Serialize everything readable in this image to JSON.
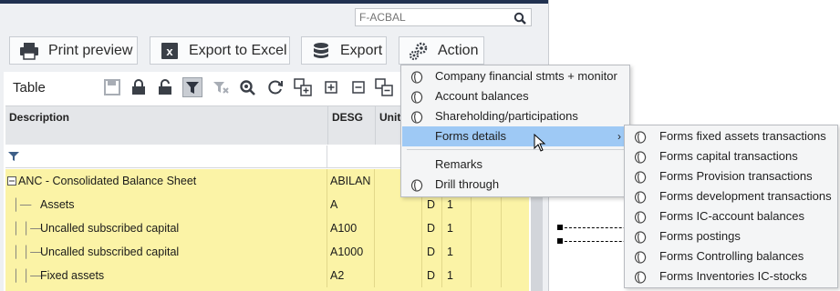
{
  "search": {
    "placeholder": "F-ACBAL"
  },
  "toolbar": {
    "print_label": "Print preview",
    "export_excel_label": "Export to Excel",
    "export_label": "Export",
    "action_label": "Action"
  },
  "table": {
    "title": "Table",
    "columns": [
      "Description",
      "DESG",
      "Unit"
    ],
    "rows": [
      {
        "desc": "ANC - Consolidated Balance Sheet",
        "desg": "ABILAN",
        "d": "",
        "n": ""
      },
      {
        "desc": "Assets",
        "desg": "A",
        "d": "D",
        "n": "1"
      },
      {
        "desc": "Uncalled subscribed capital",
        "desg": "A100",
        "d": "D",
        "n": "1"
      },
      {
        "desc": "Uncalled subscribed capital",
        "desg": "A1000",
        "d": "D",
        "n": "1"
      },
      {
        "desc": "Fixed assets",
        "desg": "A2",
        "d": "D",
        "n": "1"
      }
    ]
  },
  "action_menu": {
    "items": [
      {
        "label": "Company financial stmts + monitor"
      },
      {
        "label": "Account balances"
      },
      {
        "label": "Shareholding/participations"
      },
      {
        "label": "Forms details"
      },
      {
        "label": "Remarks"
      },
      {
        "label": "Drill through"
      }
    ],
    "highlight_color": "#9ec9f5"
  },
  "submenu": {
    "items": [
      {
        "label": "Forms fixed assets transactions"
      },
      {
        "label": "Forms capital transactions"
      },
      {
        "label": "Forms Provision transactions"
      },
      {
        "label": "Forms development transactions"
      },
      {
        "label": "Forms IC-account balances"
      },
      {
        "label": "Forms postings"
      },
      {
        "label": "Forms Controlling balances"
      },
      {
        "label": "Forms Inventories IC-stocks"
      }
    ]
  },
  "colors": {
    "row_bg": "#fbf3a6",
    "header_bg": "#e4e6e9",
    "topbar": "#203150"
  }
}
